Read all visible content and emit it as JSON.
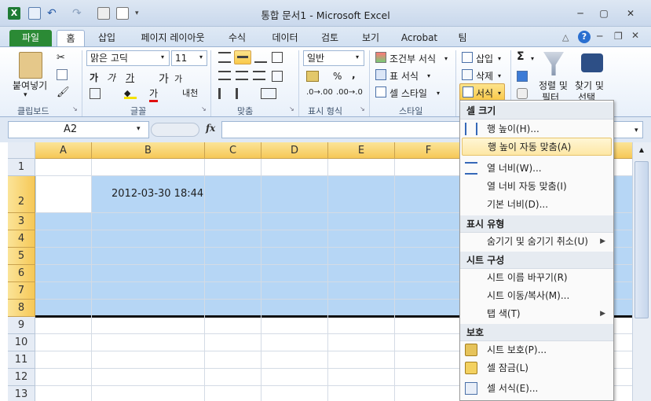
{
  "window": {
    "title": "통합 문서1  -  Microsoft Excel",
    "controls": [
      "─",
      "▢",
      "✕"
    ]
  },
  "quick_access": [
    "excel-logo-icon",
    "save-icon",
    "undo-icon",
    "redo-icon",
    "print-icon",
    "print-preview-icon",
    "customize-icon"
  ],
  "tabs": [
    {
      "label": "파일"
    },
    {
      "label": "홈"
    },
    {
      "label": "삽입"
    },
    {
      "label": "페이지 레이아웃"
    },
    {
      "label": "수식"
    },
    {
      "label": "데이터"
    },
    {
      "label": "검토"
    },
    {
      "label": "보기"
    },
    {
      "label": "Acrobat"
    },
    {
      "label": "팀"
    }
  ],
  "ribbon": {
    "clipboard": {
      "label": "클립보드",
      "paste": "붙여넣기"
    },
    "font": {
      "label": "글꼴",
      "name": "맑은 고딕",
      "size": "11",
      "bold": "가",
      "italic": "가",
      "underline": "가",
      "grow": "가",
      "shrink": "가",
      "color": "가",
      "phonetic": "내천"
    },
    "alignment": {
      "label": "맞춤"
    },
    "number": {
      "label": "표시 형식",
      "format": "일반",
      "percent": "%",
      "comma": ","
    },
    "styles": {
      "label": "스타일",
      "conditional": "조건부 서식",
      "table": "표 서식",
      "cell": "셀 스타일"
    },
    "cells": {
      "insert": "삽입",
      "delete": "삭제",
      "format": "서식"
    },
    "editing": {
      "sigma": "Σ",
      "sort": "정렬 및",
      "sort2": "필터",
      "find": "찾기 및",
      "find2": "선택"
    }
  },
  "formula_bar": {
    "name_box": "A2",
    "fx": "fx",
    "value": ""
  },
  "grid": {
    "columns": [
      "A",
      "B",
      "C",
      "D",
      "E",
      "F"
    ],
    "rows": [
      "1",
      "2",
      "3",
      "4",
      "5",
      "6",
      "7",
      "8",
      "9",
      "10",
      "11",
      "12",
      "13"
    ],
    "cell_b2": "2012-03-30 18:44"
  },
  "menu": {
    "sections": [
      {
        "header": "셀 크기",
        "items": [
          {
            "label": "행 높이(H)...",
            "icon": "row-height-icon"
          },
          {
            "label": "행 높이 자동 맞춤(A)",
            "hover": true
          },
          {
            "label": "열 너비(W)...",
            "icon": "column-width-icon"
          },
          {
            "label": "열 너비 자동 맞춤(I)"
          },
          {
            "label": "기본 너비(D)..."
          }
        ]
      },
      {
        "header": "표시 유형",
        "items": [
          {
            "label": "숨기기 및 숨기기 취소(U)",
            "submenu": true
          }
        ]
      },
      {
        "header": "시트 구성",
        "items": [
          {
            "label": "시트 이름 바꾸기(R)"
          },
          {
            "label": "시트 이동/복사(M)..."
          },
          {
            "label": "탭 색(T)",
            "submenu": true
          }
        ]
      },
      {
        "header": "보호",
        "items": [
          {
            "label": "시트 보호(P)...",
            "icon": "protect-sheet-icon"
          },
          {
            "label": "셀 잠금(L)",
            "icon": "lock-cell-icon"
          },
          {
            "label": "셀 서식(E)...",
            "icon": "format-cells-icon"
          }
        ]
      }
    ]
  },
  "colors": {
    "file_tab": "#2b8a35",
    "selection": "#b6d6f5",
    "header_gold": "#f6c857",
    "menu_hover": "#fde7a5"
  }
}
